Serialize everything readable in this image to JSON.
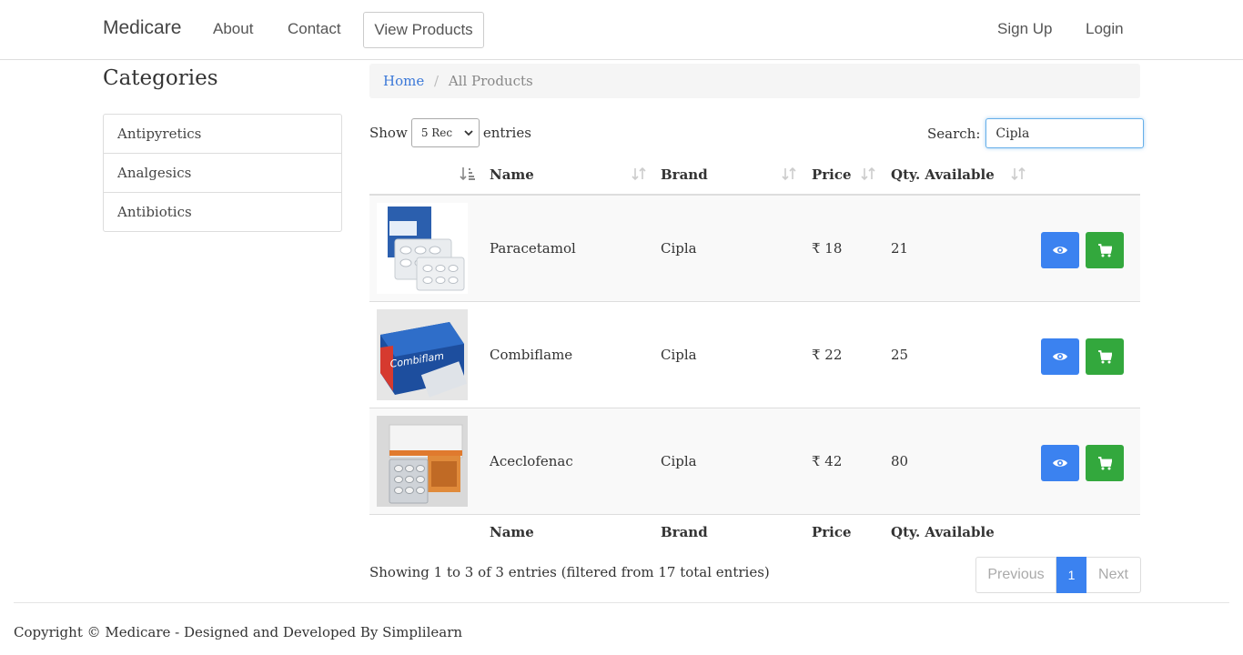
{
  "navbar": {
    "brand": "Medicare",
    "about": "About",
    "contact": "Contact",
    "view_products": "View Products",
    "sign_up": "Sign Up",
    "login": "Login"
  },
  "sidebar": {
    "title": "Categories",
    "items": [
      {
        "label": "Antipyretics"
      },
      {
        "label": "Analgesics"
      },
      {
        "label": "Antibiotics"
      }
    ]
  },
  "breadcrumb": {
    "home": "Home",
    "separator": "/",
    "current": "All Products"
  },
  "table_controls": {
    "show_label": "Show",
    "length_selected": "5 Rec",
    "entries_label": "entries",
    "search_label": "Search:",
    "search_value": "Cipla"
  },
  "table": {
    "headers": [
      "Name",
      "Brand",
      "Price",
      "Qty. Available"
    ],
    "rows": [
      {
        "name": "Paracetamol",
        "brand": "Cipla",
        "price": "₹ 18",
        "qty": "21",
        "image": "paracetamol-pack"
      },
      {
        "name": "Combiflame",
        "brand": "Cipla",
        "price": "₹ 22",
        "qty": "25",
        "image": "combiflam-pack"
      },
      {
        "name": "Aceclofenac",
        "brand": "Cipla",
        "price": "₹ 42",
        "qty": "80",
        "image": "aceclofenac-pack"
      }
    ],
    "footer": [
      "Name",
      "Brand",
      "Price",
      "Qty. Available"
    ]
  },
  "pagination": {
    "info": "Showing 1 to 3 of 3 entries (filtered from 17 total entries)",
    "previous": "Previous",
    "current_page": "1",
    "next": "Next"
  },
  "footer": {
    "copyright": "Copyright © Medicare - Designed and Developed By Simplilearn"
  },
  "colors": {
    "primary": "#3b82f0",
    "success": "#33a83d",
    "link": "#3b78d8"
  },
  "icons": {
    "view": "eye-icon",
    "cart": "cart-icon",
    "sort": "sort-icon"
  }
}
